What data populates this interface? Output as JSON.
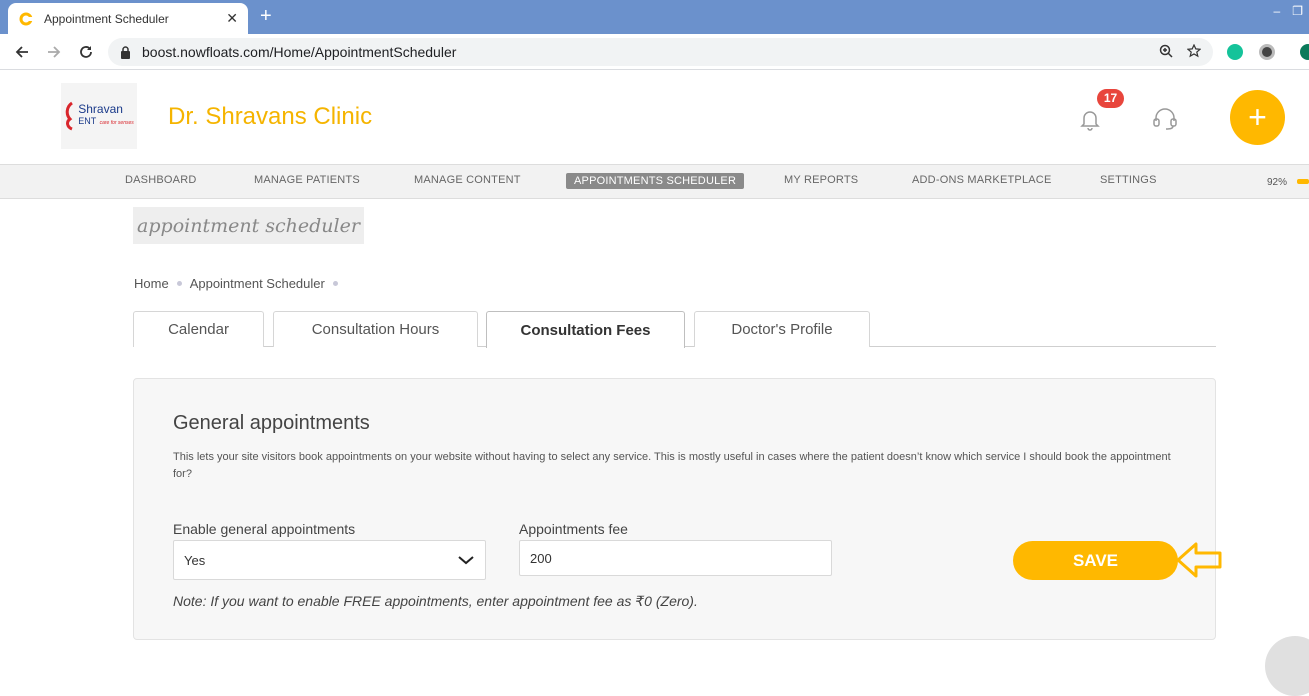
{
  "browser": {
    "tab_title": "Appointment Scheduler",
    "tab_close": "✕",
    "new_tab": "+",
    "url": "boost.nowfloats.com/Home/AppointmentScheduler"
  },
  "header": {
    "logo_line1": "Shravan",
    "logo_line2": "ENT",
    "logo_tagline": "care for senses",
    "clinic_name": "Dr. Shravans Clinic",
    "notification_count": "17",
    "fab_label": "+"
  },
  "nav": {
    "items": [
      {
        "label": "DASHBOARD"
      },
      {
        "label": "MANAGE PATIENTS"
      },
      {
        "label": "MANAGE CONTENT"
      },
      {
        "label": "APPOINTMENTS SCHEDULER"
      },
      {
        "label": "MY REPORTS"
      },
      {
        "label": "ADD-ONS MARKETPLACE"
      },
      {
        "label": "SETTINGS"
      }
    ],
    "active_index": 3,
    "completion": "92%"
  },
  "page": {
    "title": "appointment scheduler",
    "breadcrumb": [
      "Home",
      "Appointment Scheduler"
    ]
  },
  "tabs": [
    {
      "label": "Calendar"
    },
    {
      "label": "Consultation Hours"
    },
    {
      "label": "Consultation Fees"
    },
    {
      "label": "Doctor's Profile"
    }
  ],
  "active_tab": 2,
  "form": {
    "title": "General appointments",
    "description": "This lets your site visitors book appointments on your website without having to select any service. This is mostly useful in cases where the patient doesn’t know which service I should book the appointment for?",
    "enable_label": "Enable general appointments",
    "enable_value": "Yes",
    "fee_label": "Appointments fee",
    "fee_value": "200",
    "note": "Note: If you want to enable FREE appointments, enter appointment fee as ₹0 (Zero).",
    "save_label": "SAVE"
  },
  "colors": {
    "accent": "#ffb800",
    "browser_bar": "#6b91cc",
    "badge": "#e8453c"
  }
}
